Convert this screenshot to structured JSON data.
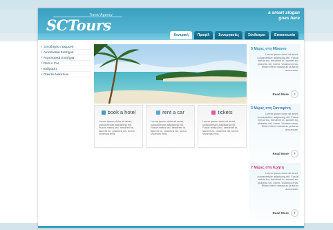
{
  "header": {
    "logo_text": "SCTours",
    "logo_tagline": "Travel Agency",
    "slogan_line1": "a smart slogan",
    "slogan_line2": "goes here"
  },
  "nav": {
    "tabs": [
      {
        "label": "Κεντρική",
        "active": true
      },
      {
        "label": "Προφίλ",
        "active": false
      },
      {
        "label": "Συνεργασίες",
        "active": false
      },
      {
        "label": "Σύνδεσμοι",
        "active": false
      },
      {
        "label": "Επικοινωνία",
        "active": false
      }
    ]
  },
  "sidebar": {
    "items": [
      {
        "label": "Ξενοδοχεία / Διαμονή"
      },
      {
        "label": "Ακτοπλοϊκά Εισιτήρια"
      },
      {
        "label": "Αεροπορικά Εισιτήρια"
      },
      {
        "label": "Rent A Car"
      },
      {
        "label": "Εκδρομές"
      },
      {
        "label": "Πακέτα Διακοπών"
      }
    ]
  },
  "boxes": [
    {
      "title": "book a hotel",
      "icon": "hotel-icon",
      "color": "#3c9fc0",
      "text": "Lorem ipsum dolor sit amet, consectetuer adipiscing elit. Fusce metus leo, hendrerit in, laoreet eu, pharetra vel, lorem. Vivamus eros."
    },
    {
      "title": "rent a car",
      "icon": "car-icon",
      "color": "#5aa7d6",
      "text": "Lorem ipsum dolor sit amet, consectetuer adipiscing elit. Fusce metus leo, hendrerit in, laoreet eu, pharetra vel, lorem. Vivamus eros."
    },
    {
      "title": "tickets",
      "icon": "ticket-icon",
      "color": "#e05a9c",
      "text": "Lorem ipsum dolor sit amet, consectetuer adipiscing elit. Fusce metus leo, hendrerit in, laoreet eu, pharetra vel, lorem. Vivamus eros."
    }
  ],
  "promos": [
    {
      "title": "5 Μέρες στη Μύκονο",
      "color": "#2a8cb3",
      "arrow_color": "#2a9a7a",
      "text": "Lorem ipsum dolor sit amet, consectetuer adipiscing elit. Fusce metus leo, hendrerit in, laoreet eu, pharetra vel, lorem. Vivamus eros. Etiam interd massa ac pulvinar accumsan.",
      "more": "Read More"
    },
    {
      "title": "3 Μέρες στη Σαντορίνη",
      "color": "#3a78c0",
      "arrow_color": "#3a78c0",
      "text": "Lorem ipsum dolor sit amet, consectetuer adipiscing elit. Fusce metus leo, hendrerit in, laoreet eu, pharetra vel, lorem. Vivamus eros. Etiam interd massa ac pulvinar accumsan.",
      "more": "Read More"
    },
    {
      "title": "7 Μέρες στη Κρήτη",
      "color": "#d8317a",
      "arrow_color": "#d8317a",
      "text": "Lorem ipsum dolor sit amet, consectetuer adipiscing elit. Fusce metus leo, hendrerit in, laoreet eu, pharetra vel, lorem. Vivamus eros. Etiam interd massa ac pulvinar accumsan.",
      "more": "Read More"
    }
  ]
}
